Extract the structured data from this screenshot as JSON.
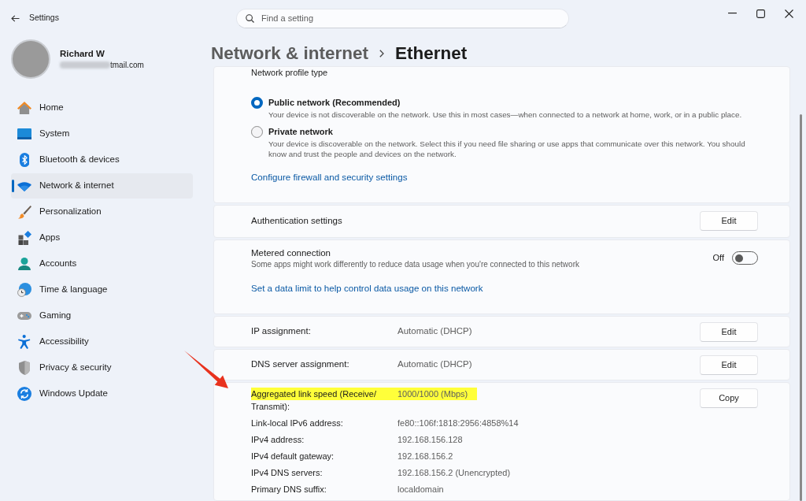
{
  "window": {
    "title": "Settings"
  },
  "search": {
    "placeholder": "Find a setting"
  },
  "account": {
    "name": "Richard W",
    "email": "tmail.com",
    "email_blurred": true
  },
  "sidebar": {
    "items": [
      {
        "label": "Home",
        "selected": false
      },
      {
        "label": "System",
        "selected": false
      },
      {
        "label": "Bluetooth & devices",
        "selected": false
      },
      {
        "label": "Network & internet",
        "selected": true
      },
      {
        "label": "Personalization",
        "selected": false
      },
      {
        "label": "Apps",
        "selected": false
      },
      {
        "label": "Accounts",
        "selected": false
      },
      {
        "label": "Time & language",
        "selected": false
      },
      {
        "label": "Gaming",
        "selected": false
      },
      {
        "label": "Accessibility",
        "selected": false
      },
      {
        "label": "Privacy & security",
        "selected": false
      },
      {
        "label": "Windows Update",
        "selected": false
      }
    ]
  },
  "breadcrumb": [
    {
      "label": "Network & internet",
      "current": false
    },
    {
      "label": "Ethernet",
      "current": true
    }
  ],
  "profile_card": {
    "heading": "Network profile type",
    "options": [
      {
        "label": "Public network (Recommended)",
        "description": "Your device is not discoverable on the network. Use this in most cases—when connected to a network at home, work, or in a public place.",
        "selected": true
      },
      {
        "label": "Private network",
        "description": "Your device is discoverable on the network. Select this if you need file sharing or use apps that communicate over this network. You should know and trust the people and devices on the network.",
        "selected": false
      }
    ],
    "link": "Configure firewall and security settings"
  },
  "cards": [
    {
      "kind": "button",
      "label": "Authentication settings",
      "button": "Edit"
    },
    {
      "kind": "toggle",
      "label": "Metered connection",
      "description": "Some apps might work differently to reduce data usage when you're connected to this network",
      "state_text": "Off",
      "on": false,
      "link": "Set a data limit to help control data usage on this network"
    },
    {
      "kind": "value",
      "label": "IP assignment:",
      "value": "Automatic (DHCP)",
      "button": "Edit"
    },
    {
      "kind": "value",
      "label": "DNS server assignment:",
      "value": "Automatic (DHCP)",
      "button": "Edit"
    },
    {
      "kind": "details",
      "button": "Copy",
      "rows": [
        {
          "label": "Aggregated link speed (Receive/Transmit):",
          "value": "1000/1000 (Mbps)",
          "highlighted": true
        },
        {
          "label": "Link-local IPv6 address:",
          "value": "fe80::106f:1818:2956:4858%14",
          "highlighted": false
        },
        {
          "label": "IPv4 address:",
          "value": "192.168.156.128",
          "highlighted": false
        },
        {
          "label": "IPv4 default gateway:",
          "value": "192.168.156.2",
          "highlighted": false
        },
        {
          "label": "IPv4 DNS servers:",
          "value": "192.168.156.2 (Unencrypted)",
          "highlighted": false
        },
        {
          "label": "Primary DNS suffix:",
          "value": "localdomain",
          "highlighted": false
        }
      ]
    }
  ]
}
